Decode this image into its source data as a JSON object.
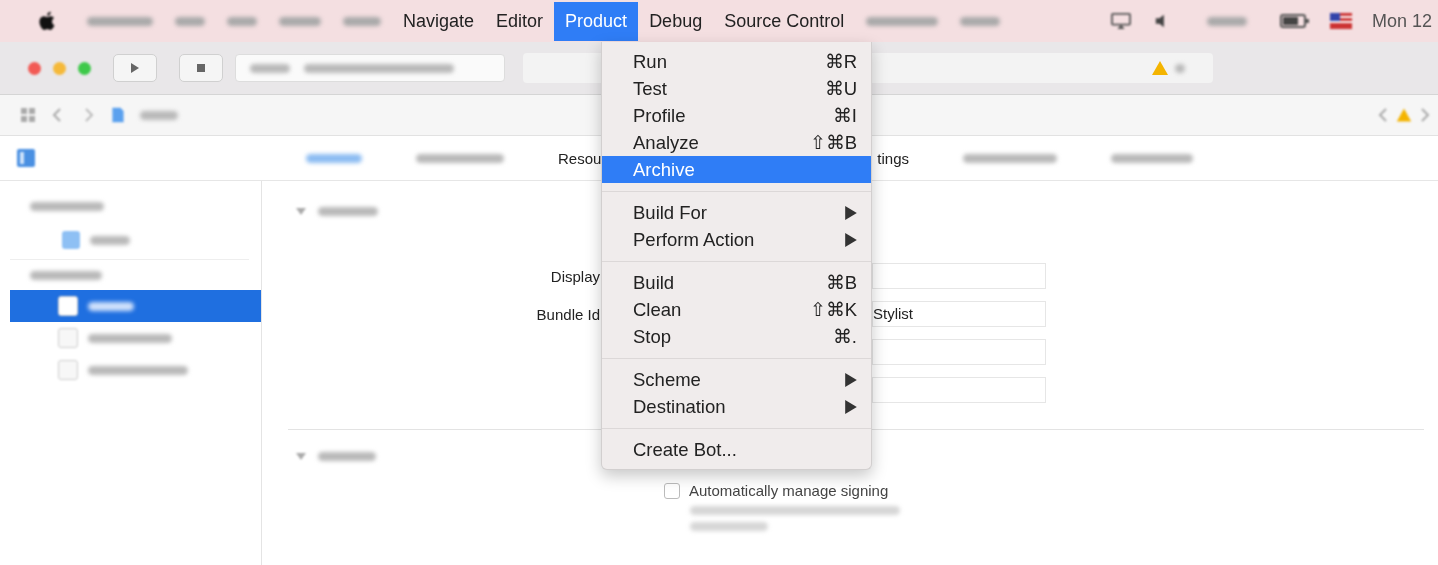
{
  "menu_bar": {
    "items": [
      {
        "kind": "blurred",
        "selected": false
      },
      {
        "kind": "blurred",
        "selected": false
      },
      {
        "kind": "blurred",
        "selected": false
      },
      {
        "kind": "blurred",
        "selected": false
      },
      {
        "kind": "blurred",
        "selected": false
      },
      {
        "kind": "text",
        "label": "Navigate",
        "selected": false
      },
      {
        "kind": "text",
        "label": "Editor",
        "selected": false
      },
      {
        "kind": "text",
        "label": "Product",
        "selected": true
      },
      {
        "kind": "text",
        "label": "Debug",
        "selected": false
      },
      {
        "kind": "text",
        "label": "Source Control",
        "selected": false
      },
      {
        "kind": "blurred",
        "selected": false
      },
      {
        "kind": "blurred",
        "selected": false
      }
    ],
    "clock": "Mon 12"
  },
  "product_menu": {
    "items": [
      {
        "kind": "item",
        "label": "Run",
        "shortcut": "⌘R",
        "selected": false
      },
      {
        "kind": "item",
        "label": "Test",
        "shortcut": "⌘U",
        "selected": false
      },
      {
        "kind": "item",
        "label": "Profile",
        "shortcut": "⌘I",
        "selected": false
      },
      {
        "kind": "item",
        "label": "Analyze",
        "shortcut": "⇧⌘B",
        "selected": false
      },
      {
        "kind": "item",
        "label": "Archive",
        "selected": true
      },
      {
        "kind": "separator"
      },
      {
        "kind": "submenu",
        "label": "Build For",
        "selected": false
      },
      {
        "kind": "submenu",
        "label": "Perform Action",
        "selected": false
      },
      {
        "kind": "separator"
      },
      {
        "kind": "item",
        "label": "Build",
        "shortcut": "⌘B",
        "selected": false
      },
      {
        "kind": "item",
        "label": "Clean",
        "shortcut": "⇧⌘K",
        "selected": false
      },
      {
        "kind": "item",
        "label": "Stop",
        "shortcut": "⌘.",
        "selected": false
      },
      {
        "kind": "separator"
      },
      {
        "kind": "submenu",
        "label": "Scheme",
        "selected": false
      },
      {
        "kind": "submenu",
        "label": "Destination",
        "selected": false
      },
      {
        "kind": "separator"
      },
      {
        "kind": "item",
        "label": "Create Bot...",
        "selected": false
      }
    ]
  },
  "tabs": [
    {
      "kind": "blurred",
      "selected": true
    },
    {
      "kind": "blurred",
      "selected": false
    },
    {
      "kind": "text",
      "label": "Resou",
      "selected": false
    },
    {
      "kind": "text",
      "label": "tings",
      "selected": false
    },
    {
      "kind": "blurred",
      "selected": false
    },
    {
      "kind": "blurred",
      "selected": false
    }
  ],
  "sidebar": {
    "items": [
      {
        "kind": "header",
        "selected": false
      },
      {
        "kind": "project",
        "selected": false
      },
      {
        "kind": "header",
        "selected": false
      },
      {
        "kind": "target",
        "selected": true
      },
      {
        "kind": "target",
        "selected": false
      },
      {
        "kind": "target",
        "selected": false
      }
    ]
  },
  "identity": {
    "rows": [
      {
        "kind": "field",
        "label": "Display"
      },
      {
        "kind": "field",
        "label": "Bundle Id",
        "value": "Stylist"
      },
      {
        "kind": "field"
      },
      {
        "kind": "field"
      }
    ]
  },
  "signing": {
    "checkbox": {
      "label": "Automatically manage signing",
      "checked": false
    }
  }
}
